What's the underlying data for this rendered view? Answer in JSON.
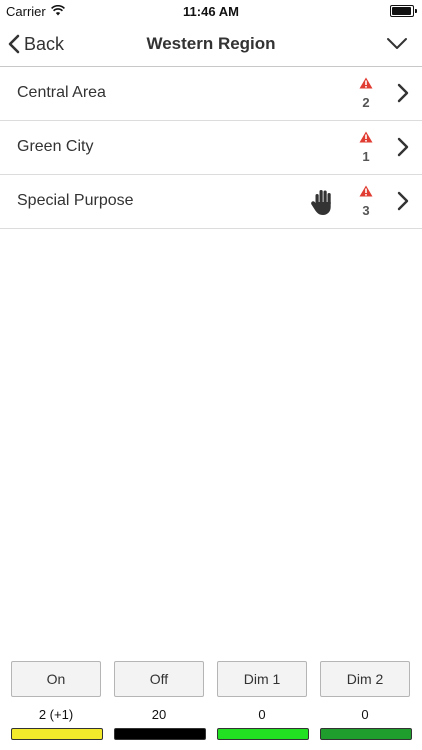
{
  "status_bar": {
    "carrier": "Carrier",
    "time": "11:46 AM"
  },
  "nav": {
    "back_label": "Back",
    "title": "Western Region"
  },
  "items": [
    {
      "label": "Central Area",
      "alert_count": "2"
    },
    {
      "label": "Green City",
      "alert_count": "1"
    },
    {
      "label": "Special Purpose",
      "alert_count": "3"
    }
  ],
  "modes": [
    {
      "label": "On",
      "count": "2 (+1)",
      "color": "#f2ea2a"
    },
    {
      "label": "Off",
      "count": "20",
      "color": "#000000"
    },
    {
      "label": "Dim 1",
      "count": "0",
      "color": "#22e022"
    },
    {
      "label": "Dim 2",
      "count": "0",
      "color": "#1f9e2e"
    }
  ],
  "colors": {
    "alert": "#e03c31",
    "text": "#333333",
    "divider": "#dcdcdc"
  }
}
